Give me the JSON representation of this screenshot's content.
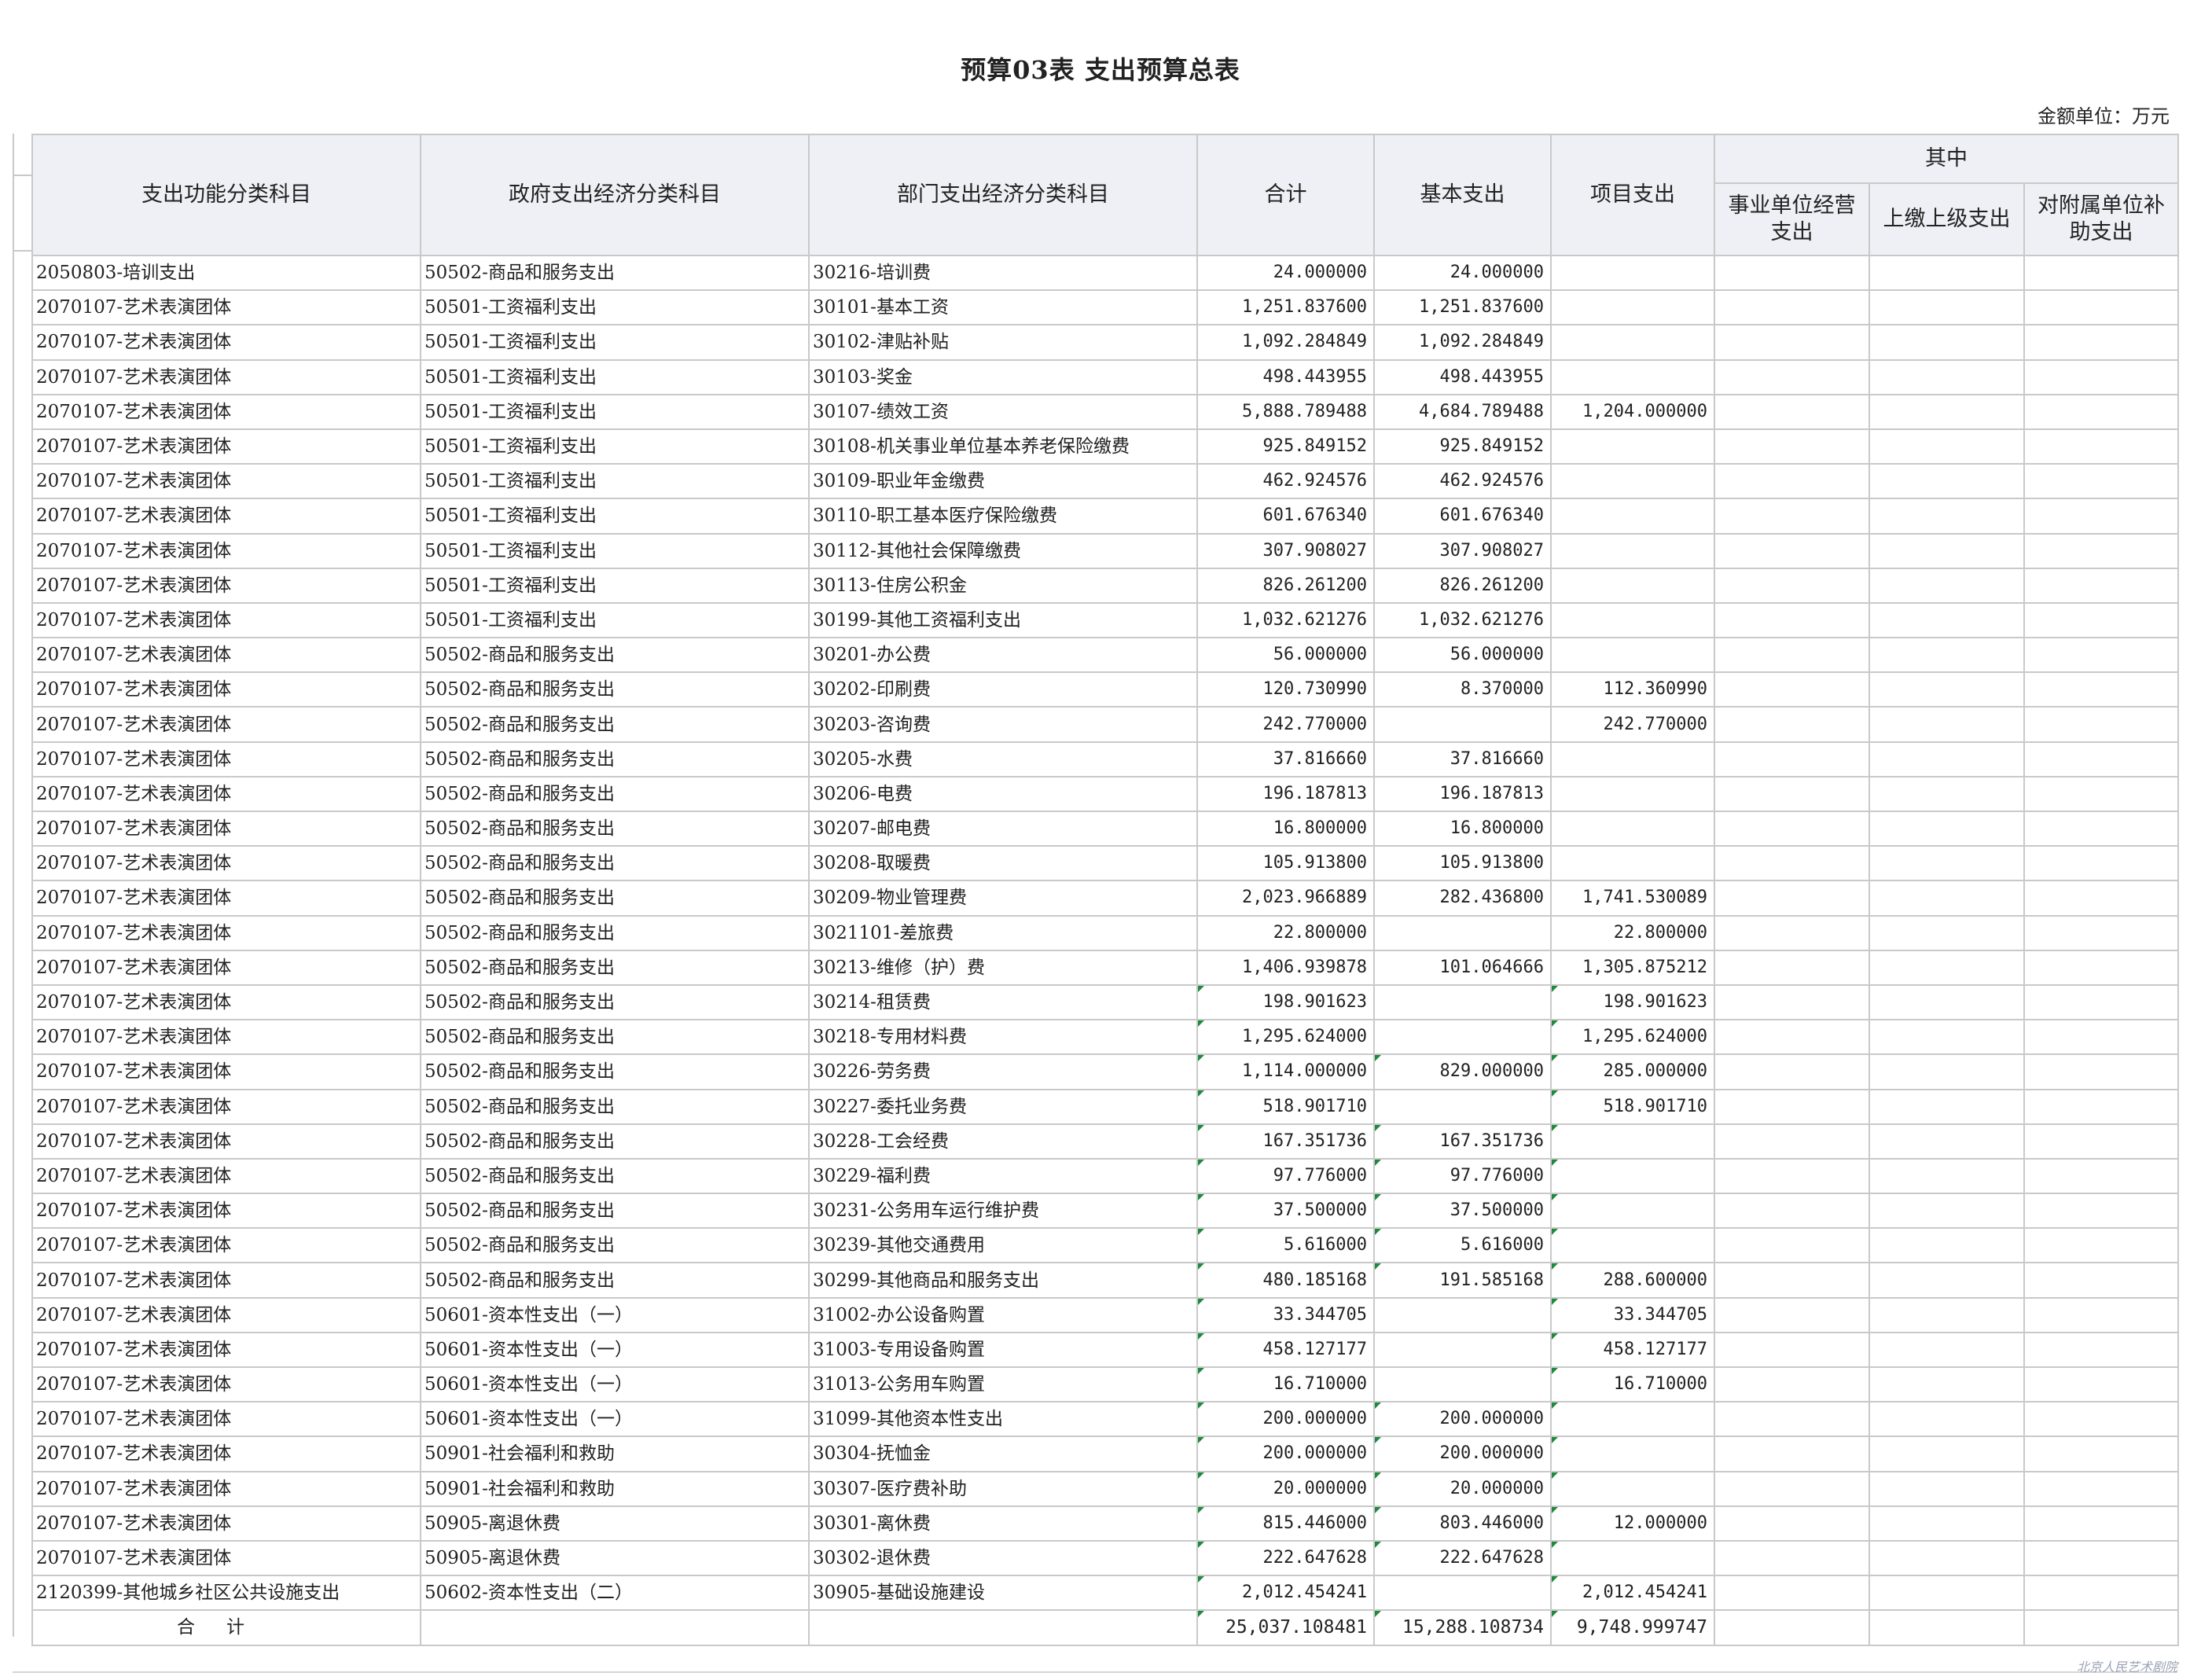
{
  "title": "预算03表  支出预算总表",
  "unit": "金额单位：万元",
  "headers": {
    "col1": "支出功能分类科目",
    "col2": "政府支出经济分类科目",
    "col3": "部门支出经济分类科目",
    "col4": "合计",
    "col5": "基本支出",
    "col6": "项目支出",
    "group": "其中",
    "sub1": "事业单位经营支出",
    "sub2": "上缴上级支出",
    "sub3": "对附属单位补助支出"
  },
  "rows": [
    [
      "2050803-培训支出",
      "50502-商品和服务支出",
      "30216-培训费",
      "24.000000",
      "24.000000",
      ""
    ],
    [
      "2070107-艺术表演团体",
      "50501-工资福利支出",
      "30101-基本工资",
      "1,251.837600",
      "1,251.837600",
      ""
    ],
    [
      "2070107-艺术表演团体",
      "50501-工资福利支出",
      "30102-津贴补贴",
      "1,092.284849",
      "1,092.284849",
      ""
    ],
    [
      "2070107-艺术表演团体",
      "50501-工资福利支出",
      "30103-奖金",
      "498.443955",
      "498.443955",
      ""
    ],
    [
      "2070107-艺术表演团体",
      "50501-工资福利支出",
      "30107-绩效工资",
      "5,888.789488",
      "4,684.789488",
      "1,204.000000"
    ],
    [
      "2070107-艺术表演团体",
      "50501-工资福利支出",
      "30108-机关事业单位基本养老保险缴费",
      "925.849152",
      "925.849152",
      ""
    ],
    [
      "2070107-艺术表演团体",
      "50501-工资福利支出",
      "30109-职业年金缴费",
      "462.924576",
      "462.924576",
      ""
    ],
    [
      "2070107-艺术表演团体",
      "50501-工资福利支出",
      "30110-职工基本医疗保险缴费",
      "601.676340",
      "601.676340",
      ""
    ],
    [
      "2070107-艺术表演团体",
      "50501-工资福利支出",
      "30112-其他社会保障缴费",
      "307.908027",
      "307.908027",
      ""
    ],
    [
      "2070107-艺术表演团体",
      "50501-工资福利支出",
      "30113-住房公积金",
      "826.261200",
      "826.261200",
      ""
    ],
    [
      "2070107-艺术表演团体",
      "50501-工资福利支出",
      "30199-其他工资福利支出",
      "1,032.621276",
      "1,032.621276",
      ""
    ],
    [
      "2070107-艺术表演团体",
      "50502-商品和服务支出",
      "30201-办公费",
      "56.000000",
      "56.000000",
      ""
    ],
    [
      "2070107-艺术表演团体",
      "50502-商品和服务支出",
      "30202-印刷费",
      "120.730990",
      "8.370000",
      "112.360990"
    ],
    [
      "2070107-艺术表演团体",
      "50502-商品和服务支出",
      "30203-咨询费",
      "242.770000",
      "",
      "242.770000"
    ],
    [
      "2070107-艺术表演团体",
      "50502-商品和服务支出",
      "30205-水费",
      "37.816660",
      "37.816660",
      ""
    ],
    [
      "2070107-艺术表演团体",
      "50502-商品和服务支出",
      "30206-电费",
      "196.187813",
      "196.187813",
      ""
    ],
    [
      "2070107-艺术表演团体",
      "50502-商品和服务支出",
      "30207-邮电费",
      "16.800000",
      "16.800000",
      ""
    ],
    [
      "2070107-艺术表演团体",
      "50502-商品和服务支出",
      "30208-取暖费",
      "105.913800",
      "105.913800",
      ""
    ],
    [
      "2070107-艺术表演团体",
      "50502-商品和服务支出",
      "30209-物业管理费",
      "2,023.966889",
      "282.436800",
      "1,741.530089"
    ],
    [
      "2070107-艺术表演团体",
      "50502-商品和服务支出",
      "3021101-差旅费",
      "22.800000",
      "",
      "22.800000"
    ],
    [
      "2070107-艺术表演团体",
      "50502-商品和服务支出",
      "30213-维修（护）费",
      "1,406.939878",
      "101.064666",
      "1,305.875212"
    ],
    [
      "2070107-艺术表演团体",
      "50502-商品和服务支出",
      "30214-租赁费",
      "198.901623",
      "",
      "198.901623"
    ],
    [
      "2070107-艺术表演团体",
      "50502-商品和服务支出",
      "30218-专用材料费",
      "1,295.624000",
      "",
      "1,295.624000"
    ],
    [
      "2070107-艺术表演团体",
      "50502-商品和服务支出",
      "30226-劳务费",
      "1,114.000000",
      "829.000000",
      "285.000000"
    ],
    [
      "2070107-艺术表演团体",
      "50502-商品和服务支出",
      "30227-委托业务费",
      "518.901710",
      "",
      "518.901710"
    ],
    [
      "2070107-艺术表演团体",
      "50502-商品和服务支出",
      "30228-工会经费",
      "167.351736",
      "167.351736",
      ""
    ],
    [
      "2070107-艺术表演团体",
      "50502-商品和服务支出",
      "30229-福利费",
      "97.776000",
      "97.776000",
      ""
    ],
    [
      "2070107-艺术表演团体",
      "50502-商品和服务支出",
      "30231-公务用车运行维护费",
      "37.500000",
      "37.500000",
      ""
    ],
    [
      "2070107-艺术表演团体",
      "50502-商品和服务支出",
      "30239-其他交通费用",
      "5.616000",
      "5.616000",
      ""
    ],
    [
      "2070107-艺术表演团体",
      "50502-商品和服务支出",
      "30299-其他商品和服务支出",
      "480.185168",
      "191.585168",
      "288.600000"
    ],
    [
      "2070107-艺术表演团体",
      "50601-资本性支出（一）",
      "31002-办公设备购置",
      "33.344705",
      "",
      "33.344705"
    ],
    [
      "2070107-艺术表演团体",
      "50601-资本性支出（一）",
      "31003-专用设备购置",
      "458.127177",
      "",
      "458.127177"
    ],
    [
      "2070107-艺术表演团体",
      "50601-资本性支出（一）",
      "31013-公务用车购置",
      "16.710000",
      "",
      "16.710000"
    ],
    [
      "2070107-艺术表演团体",
      "50601-资本性支出（一）",
      "31099-其他资本性支出",
      "200.000000",
      "200.000000",
      ""
    ],
    [
      "2070107-艺术表演团体",
      "50901-社会福利和救助",
      "30304-抚恤金",
      "200.000000",
      "200.000000",
      ""
    ],
    [
      "2070107-艺术表演团体",
      "50901-社会福利和救助",
      "30307-医疗费补助",
      "20.000000",
      "20.000000",
      ""
    ],
    [
      "2070107-艺术表演团体",
      "50905-离退休费",
      "30301-离休费",
      "815.446000",
      "803.446000",
      "12.000000"
    ],
    [
      "2070107-艺术表演团体",
      "50905-离退休费",
      "30302-退休费",
      "222.647628",
      "222.647628",
      ""
    ],
    [
      "2120399-其他城乡社区公共设施支出",
      "50602-资本性支出（二）",
      "30905-基础设施建设",
      "2,012.454241",
      "",
      "2,012.454241"
    ]
  ],
  "total": {
    "label": "合计",
    "sum": "25,037.108481",
    "basic": "15,288.108734",
    "project": "9,748.999747"
  },
  "watermark": "北京人民艺术剧院"
}
